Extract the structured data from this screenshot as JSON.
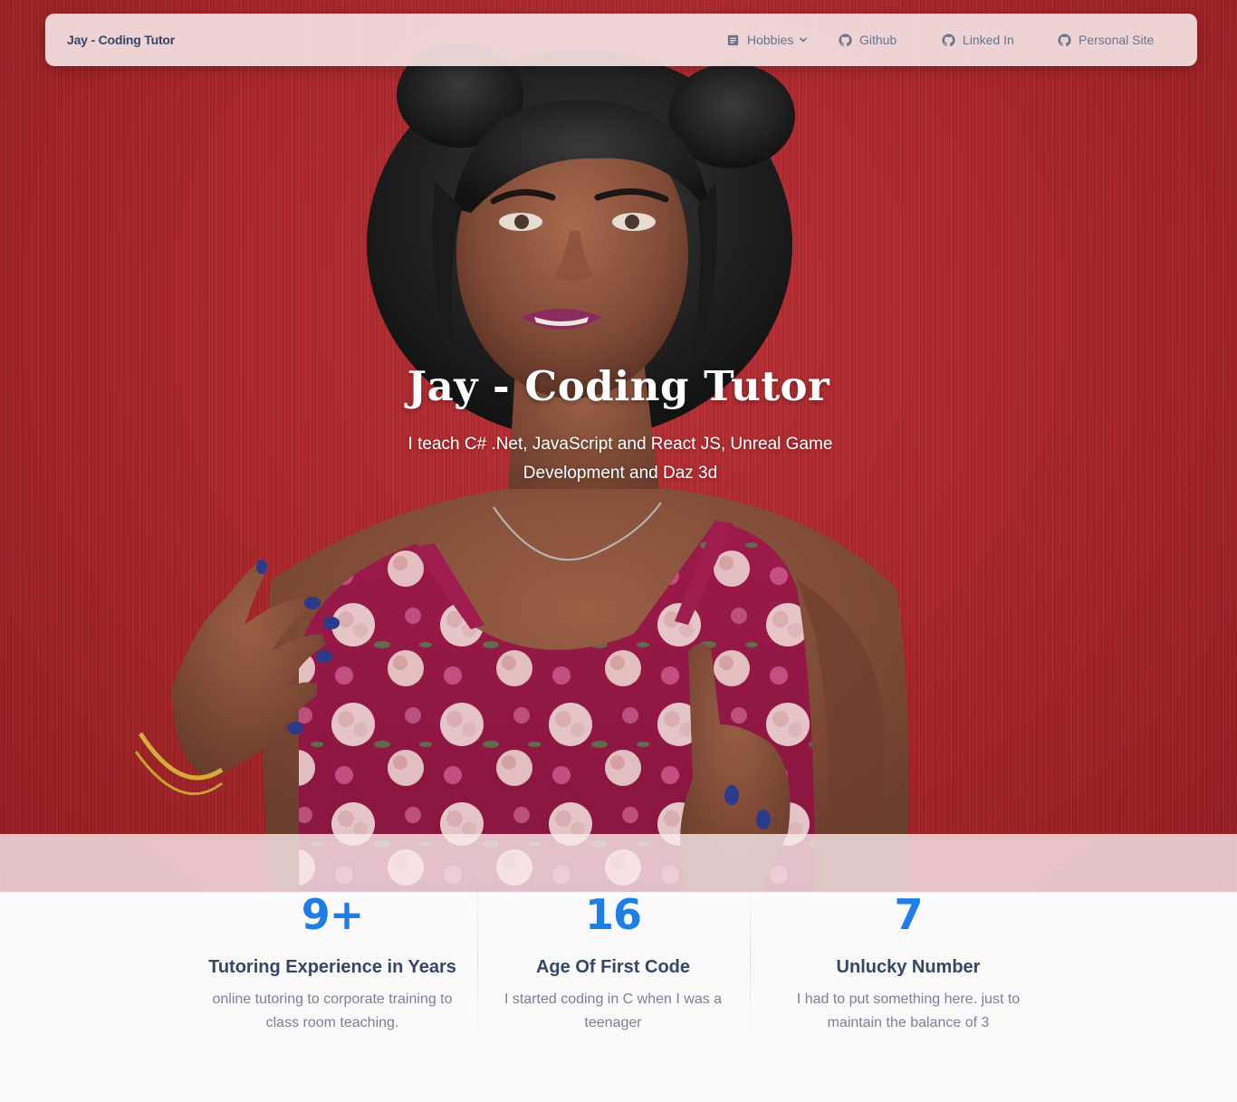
{
  "navbar": {
    "brand": "Jay - Coding Tutor",
    "items": [
      {
        "label": "Hobbies",
        "icon": "article-icon",
        "dropdown": true
      },
      {
        "label": "Github",
        "icon": "github-icon"
      },
      {
        "label": "Linked In",
        "icon": "github-icon"
      },
      {
        "label": "Personal Site",
        "icon": "github-icon"
      }
    ]
  },
  "hero": {
    "title": "Jay - Coding Tutor",
    "subtitle": "I teach C# .Net, JavaScript and React JS, Unreal Game Development and Daz 3d",
    "image": "portrait-photo"
  },
  "stats": [
    {
      "value": "9+",
      "title": "Tutoring Experience in Years",
      "description": "online tutoring to corporate training to class room teaching."
    },
    {
      "value": "16",
      "title": "Age Of First Code",
      "description": "I started coding in C when I was a teenager"
    },
    {
      "value": "7",
      "title": "Unlucky Number",
      "description": "I had to put something here. just to maintain the balance of 3"
    }
  ],
  "colors": {
    "hero_background": "#b3282c",
    "brand_text": "#344767",
    "nav_text": "#67748e",
    "stat_value": "#1f7de8",
    "stat_title": "#344767",
    "stat_description": "#7b809a"
  }
}
